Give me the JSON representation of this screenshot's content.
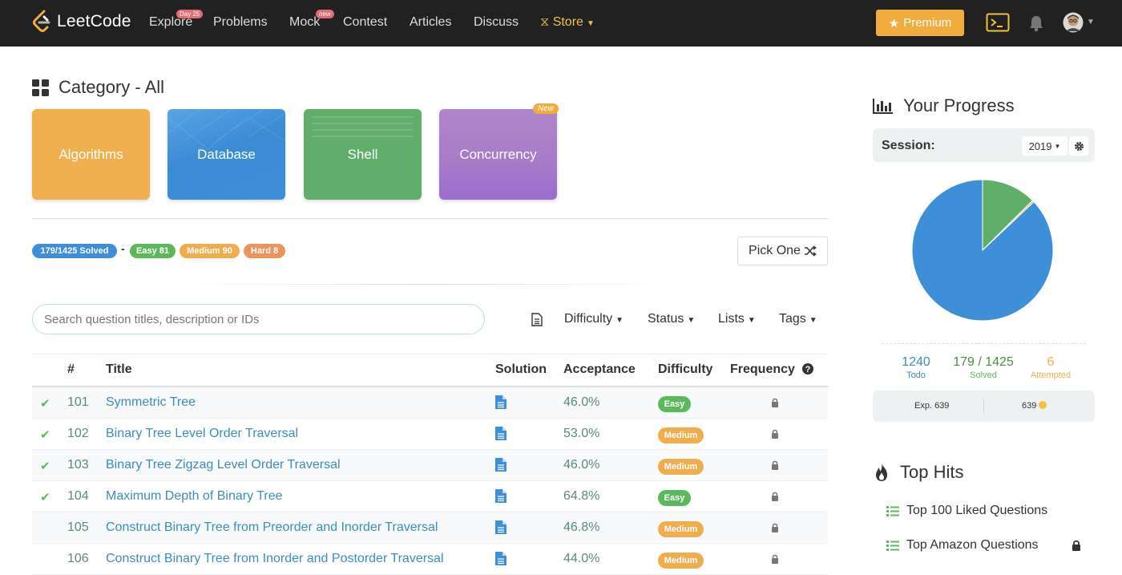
{
  "nav": {
    "logo_text": "LeetCode",
    "items": [
      {
        "label": "Explore",
        "badge": "Day 25"
      },
      {
        "label": "Problems"
      },
      {
        "label": "Mock",
        "badge": "new"
      },
      {
        "label": "Contest"
      },
      {
        "label": "Articles"
      },
      {
        "label": "Discuss"
      }
    ],
    "store_label": "Store",
    "premium_label": "Premium",
    "icons": [
      "terminal-icon",
      "bell-icon",
      "avatar",
      "chevron-down-icon"
    ],
    "colors": {
      "bg": "#212121",
      "premium": "#f0ad3e",
      "store": "#f0c33c"
    }
  },
  "category": {
    "title": "Category - All",
    "tiles": [
      {
        "label": "Algorithms",
        "color": "#f0ad4e"
      },
      {
        "label": "Database",
        "color": "#3f8fd8"
      },
      {
        "label": "Shell",
        "color": "#5fae6a"
      },
      {
        "label": "Concurrency",
        "color": "#a77bc8",
        "badge": "New"
      }
    ]
  },
  "stats": {
    "solved": "179/1425 Solved",
    "separator": "-",
    "easy": "Easy 81",
    "medium": "Medium 90",
    "hard": "Hard 8",
    "pick_one": "Pick One"
  },
  "search": {
    "placeholder": "Search question titles, description or IDs"
  },
  "filters": [
    "Difficulty",
    "Status",
    "Lists",
    "Tags"
  ],
  "table": {
    "headers": [
      "#",
      "Title",
      "Solution",
      "Acceptance",
      "Difficulty",
      "Frequency"
    ],
    "rows": [
      {
        "solved": true,
        "id": "101",
        "title": "Symmetric Tree",
        "acceptance": "46.0%",
        "difficulty": "Easy"
      },
      {
        "solved": true,
        "id": "102",
        "title": "Binary Tree Level Order Traversal",
        "acceptance": "53.0%",
        "difficulty": "Medium"
      },
      {
        "solved": true,
        "id": "103",
        "title": "Binary Tree Zigzag Level Order Traversal",
        "acceptance": "46.0%",
        "difficulty": "Medium"
      },
      {
        "solved": true,
        "id": "104",
        "title": "Maximum Depth of Binary Tree",
        "acceptance": "64.8%",
        "difficulty": "Easy"
      },
      {
        "solved": false,
        "id": "105",
        "title": "Construct Binary Tree from Preorder and Inorder Traversal",
        "acceptance": "46.8%",
        "difficulty": "Medium"
      },
      {
        "solved": false,
        "id": "106",
        "title": "Construct Binary Tree from Inorder and Postorder Traversal",
        "acceptance": "44.0%",
        "difficulty": "Medium"
      }
    ]
  },
  "progress": {
    "title": "Your Progress",
    "session_label": "Session:",
    "session_value": "2019",
    "chart_data": {
      "type": "pie",
      "slices": [
        {
          "value": 1240,
          "color": "#3f8fd8"
        },
        {
          "value": 179,
          "color": "#5fae6a"
        },
        {
          "value": 6,
          "color": "#f0ad4e"
        }
      ]
    },
    "todo": {
      "value": "1240",
      "label": "Todo"
    },
    "solved": {
      "value": "179 / 1425",
      "label": "Solved"
    },
    "attempted": {
      "value": "6",
      "label": "Attempted"
    },
    "exp": "Exp. 639",
    "coins": "639"
  },
  "top_hits": {
    "title": "Top Hits",
    "items": [
      {
        "label": "Top 100 Liked Questions",
        "locked": false
      },
      {
        "label": "Top Amazon Questions",
        "locked": true
      }
    ]
  }
}
